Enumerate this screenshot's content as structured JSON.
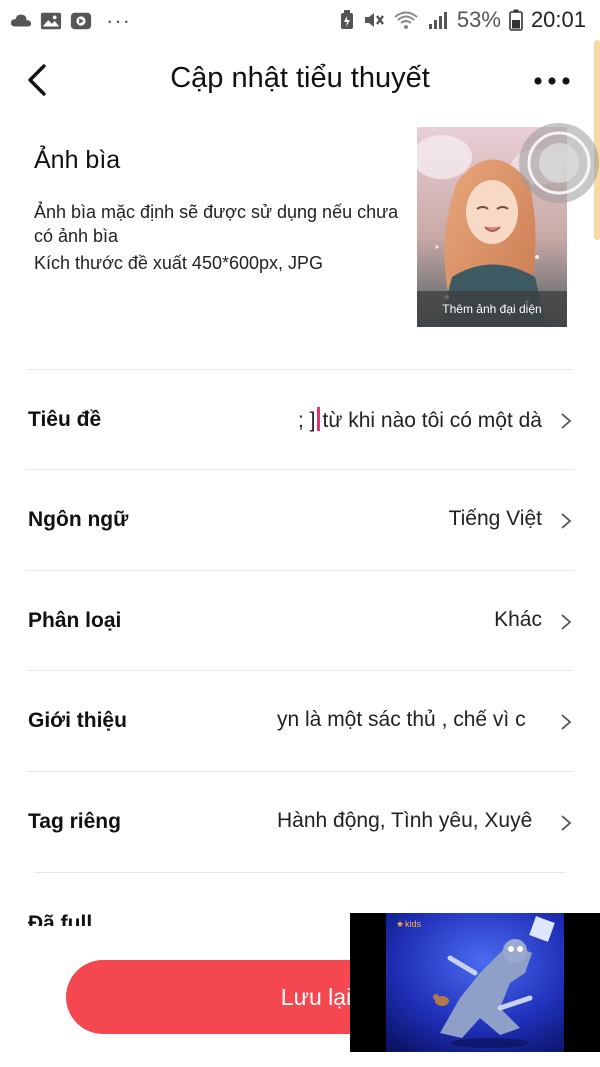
{
  "status_bar": {
    "left_icons": [
      "cloud-icon",
      "image-icon",
      "screen-record-icon"
    ],
    "more": "···",
    "right_icons": [
      "battery-saver-icon",
      "mute-icon",
      "wifi-icon",
      "signal-icon"
    ],
    "battery": "53%",
    "time": "20:01"
  },
  "header": {
    "title": "Cập nhật tiểu thuyết",
    "back_icon": "back-arrow-icon",
    "more_icon": "more-dots-icon"
  },
  "cover": {
    "title": "Ảnh bìa",
    "description": "Ảnh bìa mặc định sẽ được sử dụng nếu chưa có ảnh bìa",
    "size_hint": "Kích thước đề xuất 450*600px, JPG",
    "caption": "Thêm ảnh đại diện"
  },
  "rows": [
    {
      "label": "Tiêu đề",
      "value": "từ khi nào tôi có một dà",
      "prefix": "; ]"
    },
    {
      "label": "Ngôn ngữ",
      "value": "Tiếng Việt"
    },
    {
      "label": "Phân loại",
      "value": "Khác"
    },
    {
      "label": "Giới thiệu",
      "value": "yn là một sác thủ , chế vì c"
    },
    {
      "label": "Tag riêng",
      "value": "Hành động, Tình yêu, Xuyê"
    }
  ],
  "partial_row": {
    "label": "Đã full"
  },
  "save_button": {
    "label": "Lưu lại"
  },
  "mini_player": {
    "channel": "kids"
  },
  "colors": {
    "accent": "#f5474f",
    "cursor": "#e7336b"
  }
}
